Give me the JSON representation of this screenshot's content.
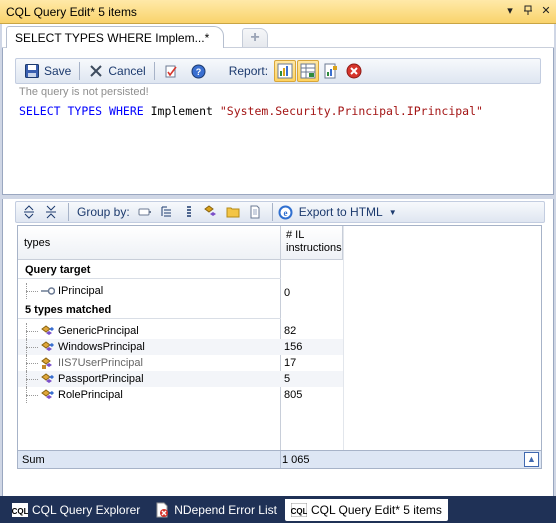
{
  "window": {
    "title": "CQL Query Edit*  5 items"
  },
  "doc_tab": {
    "label": "SELECT TYPES WHERE Implem...*"
  },
  "toolbar": {
    "save_label": "Save",
    "cancel_label": "Cancel",
    "report_label": "Report:"
  },
  "status": {
    "not_persisted": "The query is not persisted!"
  },
  "query": {
    "kw1": "SELECT",
    "kw2": "TYPES",
    "kw3": "WHERE",
    "rest": "Implement",
    "str": "\"System.Security.Principal.IPrincipal\""
  },
  "results_toolbar": {
    "group_by_label": "Group by:",
    "export_label": "Export to HTML"
  },
  "grid": {
    "col_types": "types",
    "col_il": "# IL instructions",
    "group1": "Query target",
    "group1_rows": [
      {
        "name": "IPrincipal",
        "value": "0"
      }
    ],
    "group2": "5 types matched",
    "group2_rows": [
      {
        "name": "GenericPrincipal",
        "value": "82"
      },
      {
        "name": "WindowsPrincipal",
        "value": "156"
      },
      {
        "name": "IIS7UserPrincipal",
        "value": "17"
      },
      {
        "name": "PassportPrincipal",
        "value": "5"
      },
      {
        "name": "RolePrincipal",
        "value": "805"
      }
    ],
    "sum_label": "Sum",
    "sum_value": "1 065"
  },
  "bottom_tabs": [
    {
      "label": "CQL Query Explorer"
    },
    {
      "label": "NDepend Error List"
    },
    {
      "label": "CQL Query Edit*  5 items"
    }
  ],
  "colors": {
    "titlebar": "#f9d36c",
    "accent": "#1c3a6e",
    "bottombar": "#1f3156"
  }
}
